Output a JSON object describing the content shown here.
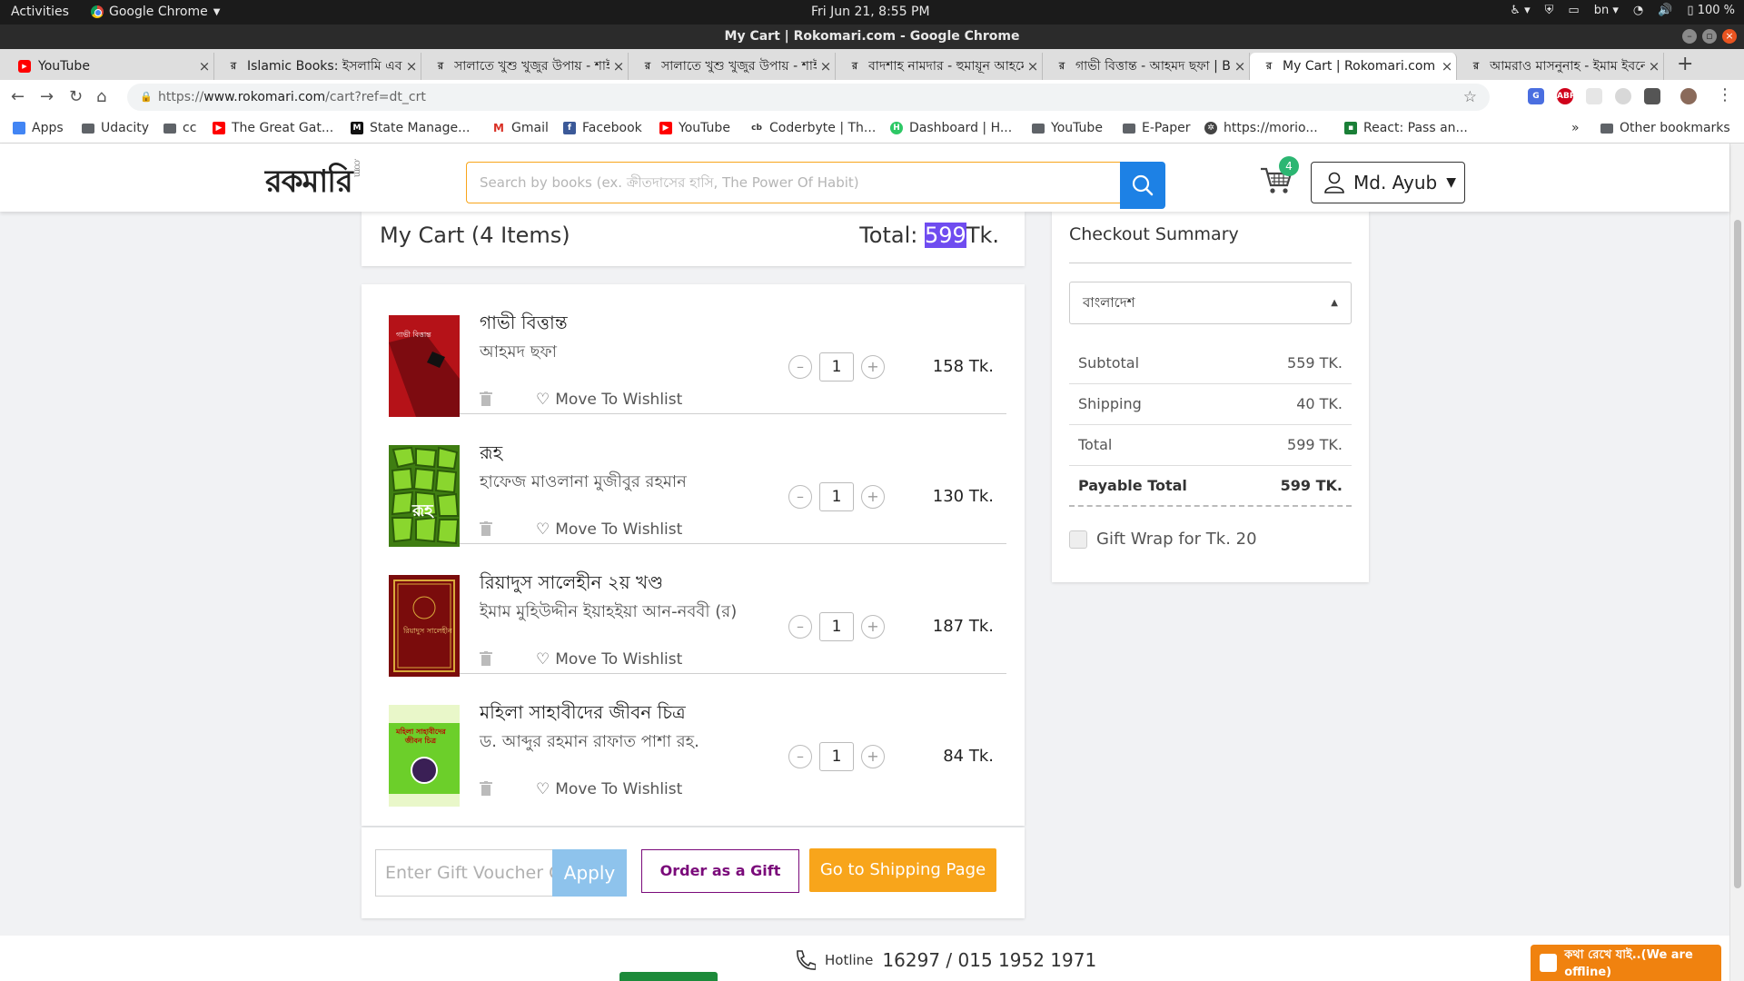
{
  "os_bar": {
    "activities": "Activities",
    "app_name": "Google Chrome",
    "clock": "Fri Jun 21,  8:55 PM",
    "lang": "bn",
    "battery": "100 %"
  },
  "window": {
    "title": "My Cart | Rokomari.com - Google Chrome"
  },
  "tabs": [
    {
      "title": "YouTube",
      "favicon": "youtube-icon"
    },
    {
      "title": "Islamic Books: ইসলামি এব",
      "favicon": "rokomari-icon"
    },
    {
      "title": "সালাতে খুশু খুজুর উপায় - শাই",
      "favicon": "rokomari-icon"
    },
    {
      "title": "সালাতে খুশু খুজুর উপায় - শাই",
      "favicon": "rokomari-icon"
    },
    {
      "title": "বাদশাহ নামদার - হুমায়ূন আহমে",
      "favicon": "rokomari-icon"
    },
    {
      "title": "গাভী বিত্তান্ত - আহমদ ছফা | Bu",
      "favicon": "rokomari-icon"
    },
    {
      "title": "My Cart | Rokomari.com",
      "favicon": "rokomari-icon",
      "active": true
    },
    {
      "title": "আমরাও মাসনুনাহ - ইমাম ইবনে",
      "favicon": "rokomari-icon"
    }
  ],
  "address": {
    "prefix": "https://",
    "host": "www.rokomari.com",
    "path": "/cart?ref=dt_crt"
  },
  "bookmarks": [
    {
      "label": "Apps",
      "icon": "apps-grid-icon"
    },
    {
      "label": "Udacity",
      "icon": "folder-icon"
    },
    {
      "label": "cc",
      "icon": "folder-icon"
    },
    {
      "label": "The Great Gat...",
      "icon": "youtube-icon"
    },
    {
      "label": "State Manage...",
      "icon": "medium-icon"
    },
    {
      "label": "Gmail",
      "icon": "gmail-icon"
    },
    {
      "label": "Facebook",
      "icon": "facebook-icon"
    },
    {
      "label": "YouTube",
      "icon": "youtube-icon"
    },
    {
      "label": "Coderbyte | Th...",
      "icon": "coderbyte-icon"
    },
    {
      "label": "Dashboard | H...",
      "icon": "hackerrank-icon"
    },
    {
      "label": "YouTube",
      "icon": "folder-icon"
    },
    {
      "label": "E-Paper",
      "icon": "folder-icon"
    },
    {
      "label": "https://morio...",
      "icon": "gear-icon"
    },
    {
      "label": "React: Pass an...",
      "icon": "react-icon"
    }
  ],
  "bookmarks_more": "»",
  "bookmarks_other": "Other bookmarks",
  "header": {
    "logo": "রকমারি",
    "logo_suffix": ".com",
    "search_placeholder": "Search by books (ex. ক্রীতদাসের হাসি, The Power Of Habit)",
    "cart_count": "4",
    "user_name": "Md. Ayub"
  },
  "cart": {
    "title": "My Cart (4 Items)",
    "total_label": "Total:",
    "total_value": "599",
    "total_unit": "Tk.",
    "wishlist_label": "Move  To  Wishlist",
    "items": [
      {
        "name": "গাভী বিত্তান্ত",
        "author": "আহমদ ছফা",
        "qty": "1",
        "price": "158 Tk.",
        "cover_color": "#c0151c"
      },
      {
        "name": "রূহ",
        "author": "হাফেজ মাওলানা মুজীবুর রহমান",
        "qty": "1",
        "price": "130 Tk.",
        "cover_color": "#5aa61a"
      },
      {
        "name": "রিয়াদুস সালেহীন ২য় খণ্ড",
        "author": "ইমাম মুহিউদ্দীন ইয়াহইয়া আন-নববী (র)",
        "qty": "1",
        "price": "187 Tk.",
        "cover_color": "#8a1010"
      },
      {
        "name": "মহিলা সাহাবীদের জীবন চিত্র",
        "author": "ড. আব্দুর রহমান রাফাত পাশা রহ.",
        "qty": "1",
        "price": "84 Tk.",
        "cover_color": "#7ed321"
      }
    ],
    "voucher_placeholder": "Enter Gift Voucher Code",
    "apply_label": "Apply",
    "order_gift_label": "Order as a Gift",
    "shipping_label": "Go to Shipping Page"
  },
  "summary": {
    "title": "Checkout Summary",
    "country": "বাংলাদেশ",
    "rows": [
      {
        "label": "Subtotal",
        "value": "559 TK."
      },
      {
        "label": "Shipping",
        "value": "40 TK."
      },
      {
        "label": "Total",
        "value": "599 TK."
      },
      {
        "label": "Payable Total",
        "value": "599 TK."
      }
    ],
    "gift_wrap": "Gift Wrap for Tk. 20"
  },
  "footer": {
    "hotline_label": "Hotline",
    "hotline_number": "16297 / 015 1952 1971",
    "chat_label": "কথা রেখে যাই..(We are offline)"
  }
}
